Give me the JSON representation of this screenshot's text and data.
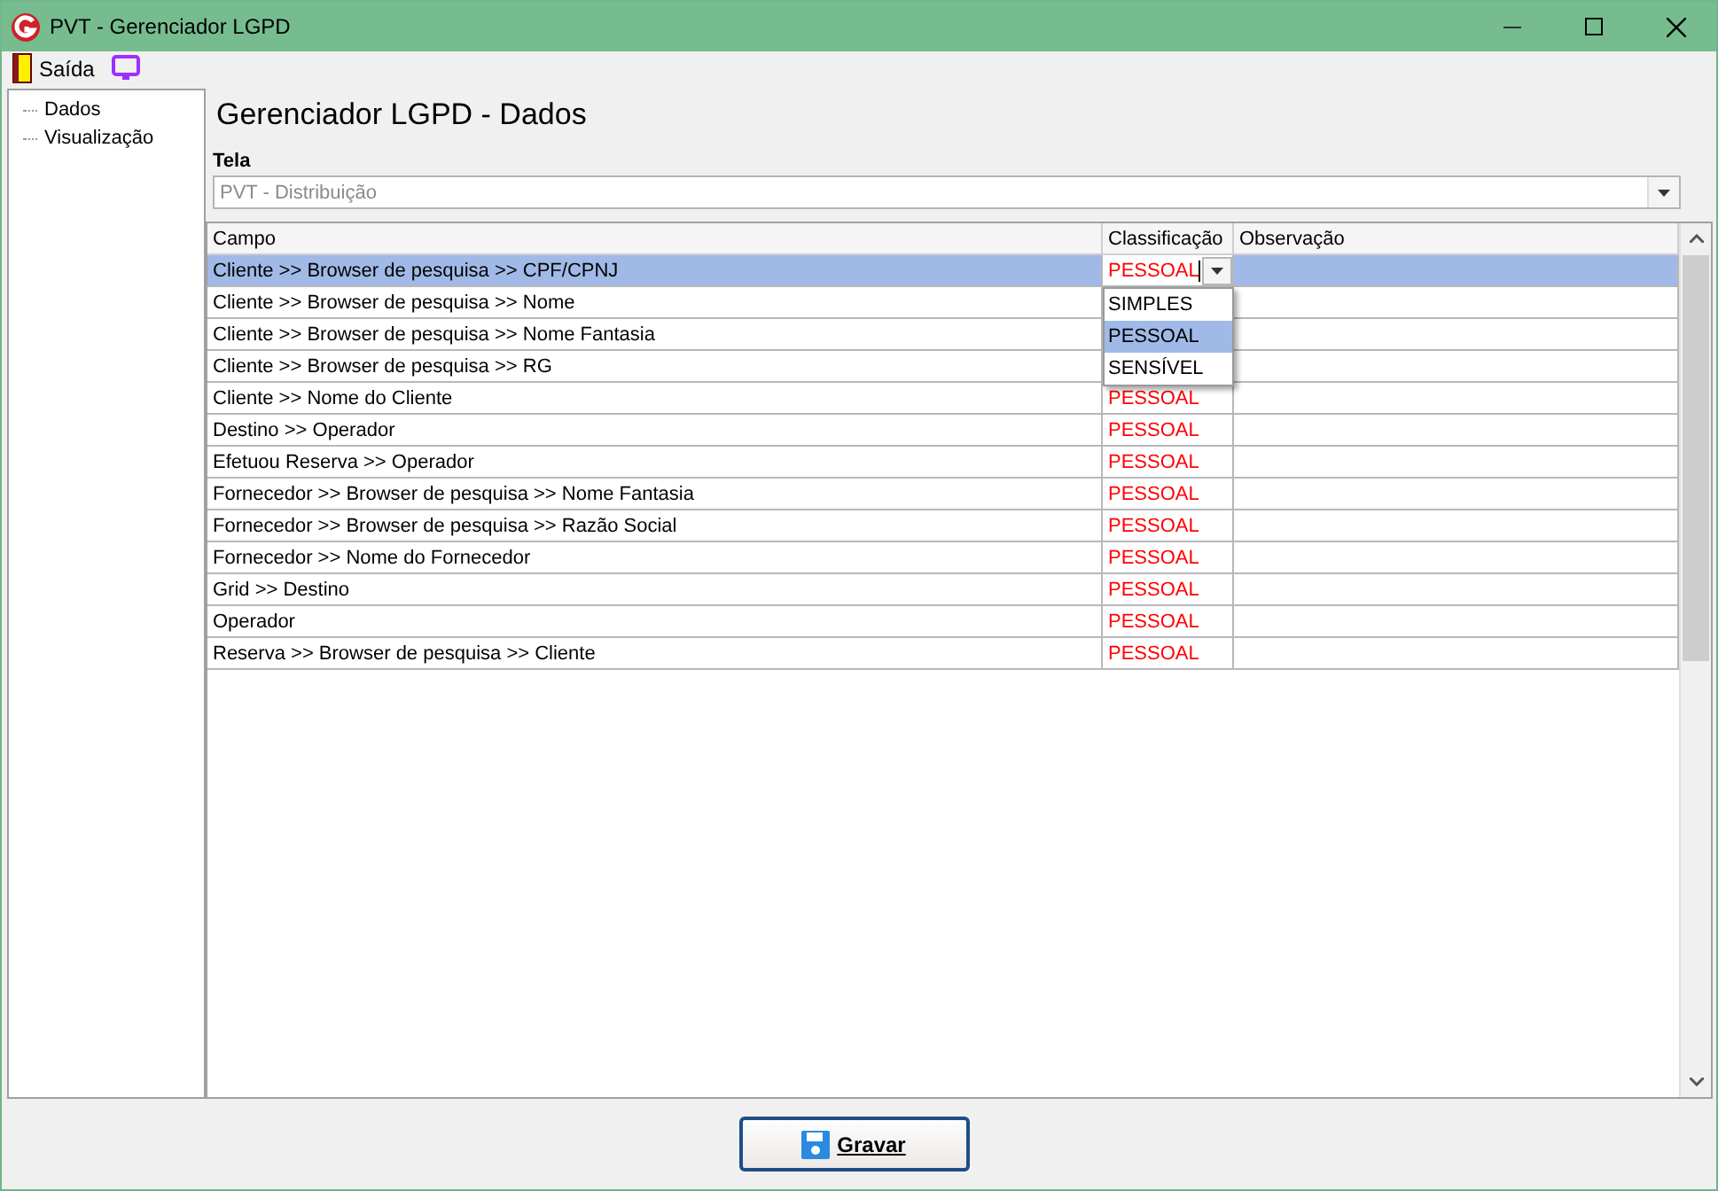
{
  "window": {
    "title": "PVT - Gerenciador LGPD"
  },
  "menu": [
    {
      "label": "Saída",
      "kind": "exit"
    },
    {
      "kind": "monitor"
    }
  ],
  "sidebar": {
    "items": [
      {
        "label": "Dados",
        "selected": false
      },
      {
        "label": "Visualização",
        "selected": false
      }
    ]
  },
  "page_title": "Gerenciador LGPD - Dados",
  "tela": {
    "label": "Tela",
    "value": "PVT - Distribuição"
  },
  "table": {
    "columns": [
      "Campo",
      "Classificação",
      "Observação"
    ],
    "rows": [
      {
        "campo": "Cliente >> Browser de pesquisa >> CPF/CPNJ",
        "classificacao": "PESSOAL",
        "selected": true,
        "editing": true
      },
      {
        "campo": "Cliente >> Browser de pesquisa >> Nome",
        "selected": false
      },
      {
        "campo": "Cliente >> Browser de pesquisa >> Nome Fantasia",
        "selected": false
      },
      {
        "campo": "Cliente >> Browser de pesquisa >> RG",
        "selected": false
      },
      {
        "campo": "Cliente >> Nome do Cliente",
        "classificacao": "PESSOAL",
        "selected": false
      },
      {
        "campo": "Destino >> Operador",
        "classificacao": "PESSOAL",
        "selected": false
      },
      {
        "campo": "Efetuou Reserva >> Operador",
        "classificacao": "PESSOAL",
        "selected": false
      },
      {
        "campo": "Fornecedor >> Browser de pesquisa >> Nome Fantasia",
        "classificacao": "PESSOAL",
        "selected": false
      },
      {
        "campo": "Fornecedor >> Browser de pesquisa >> Razão Social",
        "classificacao": "PESSOAL",
        "selected": false
      },
      {
        "campo": "Fornecedor >> Nome do Fornecedor",
        "classificacao": "PESSOAL",
        "selected": false
      },
      {
        "campo": "Grid >> Destino",
        "classificacao": "PESSOAL",
        "selected": false
      },
      {
        "campo": "Operador",
        "classificacao": "PESSOAL",
        "selected": false
      },
      {
        "campo": "Reserva >> Browser de pesquisa >> Cliente",
        "classificacao": "PESSOAL",
        "selected": false
      }
    ],
    "dropdown": {
      "open": true,
      "options": [
        {
          "label": "SIMPLES",
          "selected": false
        },
        {
          "label": "PESSOAL",
          "selected": true
        },
        {
          "label": "SENSÍVEL",
          "selected": false
        }
      ]
    }
  },
  "save_button": {
    "label": "Gravar"
  }
}
